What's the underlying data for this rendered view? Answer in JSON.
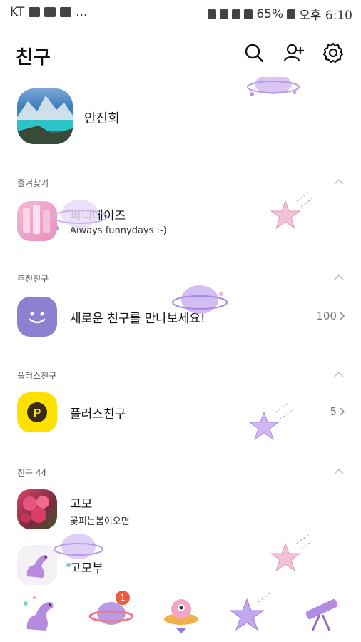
{
  "status_bar": {
    "carrier": "KT",
    "ellipsis": "...",
    "battery": "65%",
    "time": "오후 6:10"
  },
  "header": {
    "title": "친구"
  },
  "profile": {
    "name": "안진희"
  },
  "sections": {
    "favorites": {
      "label": "즐겨찾기",
      "items": [
        {
          "name": "퍼니데이즈",
          "status": "Always funnydays :-)"
        }
      ]
    },
    "recommended": {
      "label": "추천친구",
      "message": "새로운 친구를 만나보세요!",
      "count": "100"
    },
    "plus": {
      "label": "플러스친구",
      "item_name": "플러스친구",
      "count": "5"
    },
    "friends": {
      "label": "친구 44",
      "items": [
        {
          "name": "고모",
          "status": "꽃피는봄이오면"
        },
        {
          "name": "고모부",
          "status": ""
        }
      ]
    }
  },
  "bottom_nav": {
    "items": [
      {
        "icon": "dinosaur-icon"
      },
      {
        "icon": "planet-chat-icon",
        "badge": "1"
      },
      {
        "icon": "alien-ufo-icon"
      },
      {
        "icon": "star-icon"
      },
      {
        "icon": "telescope-icon"
      }
    ]
  },
  "colors": {
    "accent_purple": "#b89be6",
    "kakao_yellow": "#ffe100",
    "badge_red": "#f05a3c"
  }
}
